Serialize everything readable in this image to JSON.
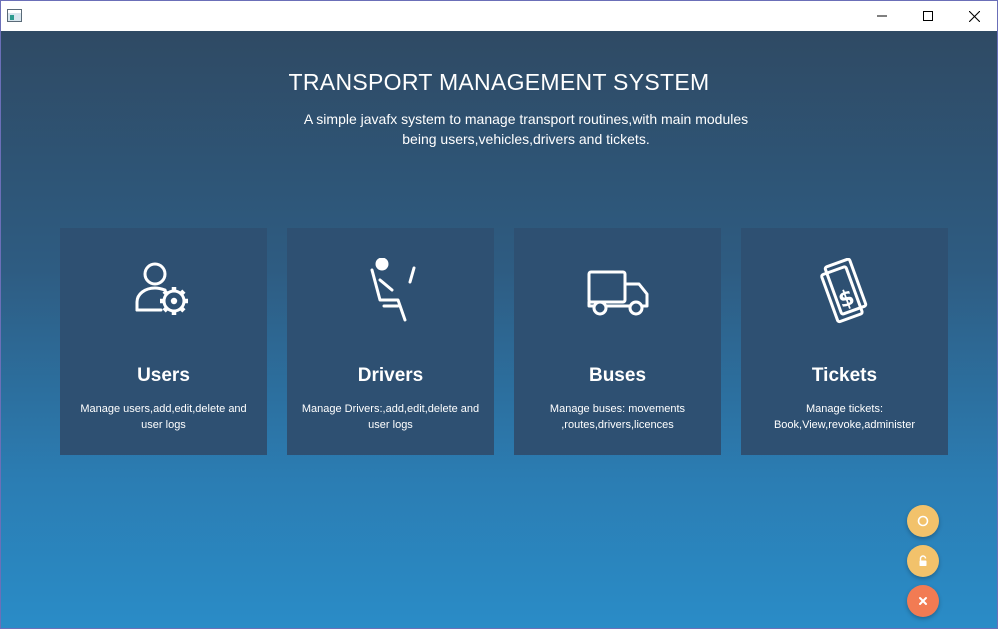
{
  "window": {
    "title": "",
    "app_icon": "app-window-icon",
    "controls": [
      "minimize-icon",
      "maximize-icon",
      "close-icon"
    ]
  },
  "header": {
    "title": "TRANSPORT MANAGEMENT SYSTEM",
    "subtitle": "A simple javafx system to manage transport routines,with main modules being users,vehicles,drivers and tickets."
  },
  "cards": [
    {
      "title": "Users",
      "description": "Manage users,add,edit,delete and user logs",
      "icon": "user-gear-icon"
    },
    {
      "title": "Drivers",
      "description": "Manage Drivers:,add,edit,delete and user logs",
      "icon": "seated-driver-icon"
    },
    {
      "title": "Buses",
      "description": "Manage buses: movements ,routes,drivers,licences",
      "icon": "truck-icon"
    },
    {
      "title": "Tickets",
      "description": "Manage tickets: Book,View,revoke,administer",
      "icon": "dollar-tickets-icon"
    }
  ],
  "floating_actions": [
    {
      "icon": "circle-icon",
      "color": "#f2c26b"
    },
    {
      "icon": "unlock-icon",
      "color": "#f2c26b"
    },
    {
      "icon": "close-icon",
      "color": "#f27b53"
    }
  ],
  "colors": {
    "card_background": "#2e5072",
    "gradient_top": "#2f4a64",
    "gradient_bottom": "#2a8cc7",
    "fab_yellow": "#f2c26b",
    "fab_orange": "#f27b53"
  }
}
